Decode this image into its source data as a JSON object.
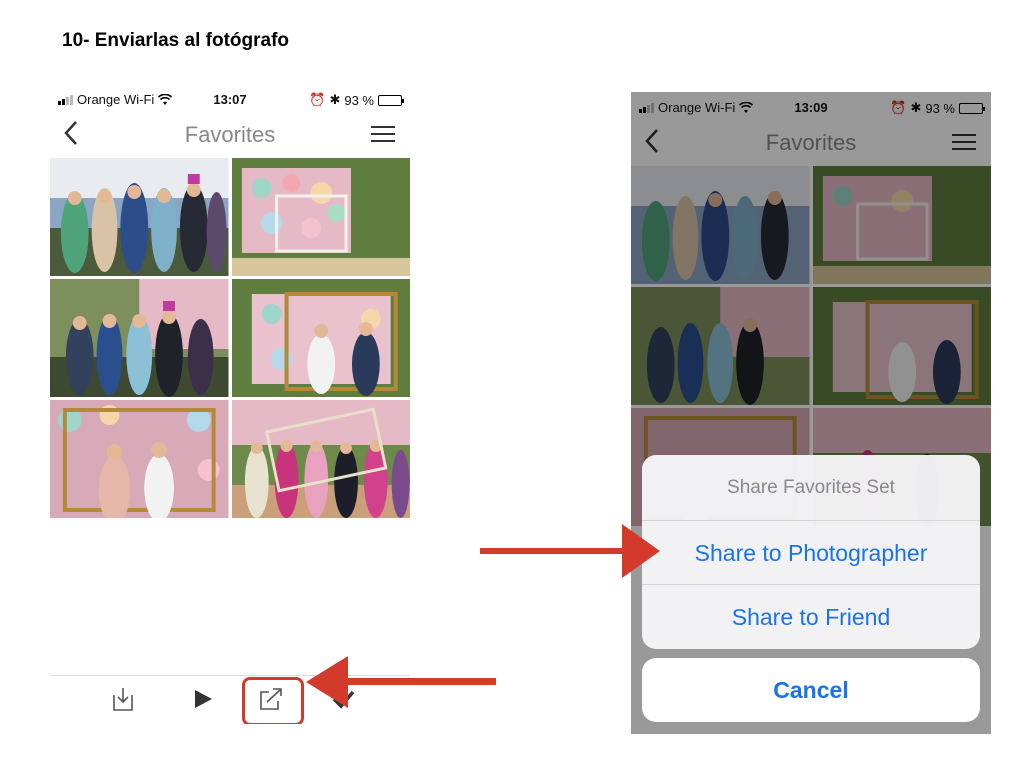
{
  "heading": "10- Enviarlas al fotógrafo",
  "colors": {
    "accent": "#1a73e8",
    "annotation": "#d33a2c",
    "title_gray": "#888888"
  },
  "left_phone": {
    "status": {
      "carrier": "Orange Wi-Fi",
      "time": "13:07",
      "battery": "93 %",
      "battery_level": 0.93
    },
    "nav": {
      "title": "Favorites",
      "back_icon": "chevron-left-icon",
      "menu_icon": "hamburger-menu-icon"
    },
    "photos": [
      "party-group-photo",
      "flower-wall-frame-photo",
      "party-group-photo",
      "flower-wall-frame-photo",
      "flower-wall-frame-photo",
      "party-group-photo"
    ],
    "toolbar": [
      "download-icon",
      "play-icon",
      "share-icon",
      "checkmark-icon"
    ]
  },
  "right_phone": {
    "status": {
      "carrier": "Orange Wi-Fi",
      "time": "13:09",
      "battery": "93 %",
      "battery_level": 0.93
    },
    "nav": {
      "title": "Favorites"
    },
    "action_sheet": {
      "title": "Share Favorites Set",
      "option_photographer": "Share to Photographer",
      "option_friend": "Share to Friend",
      "cancel": "Cancel"
    }
  }
}
